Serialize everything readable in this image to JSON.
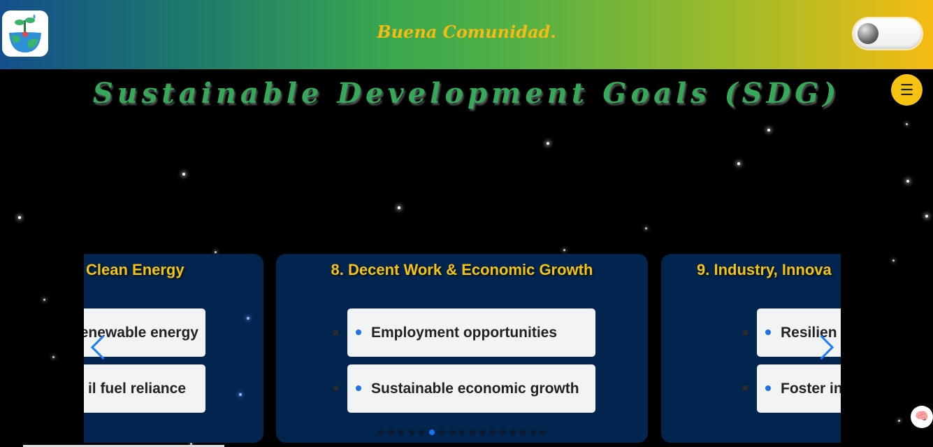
{
  "header": {
    "brand_text": "Buena Comunidad.",
    "logo_icon": "sdg-earth-plant-logo",
    "theme_toggle_state": "off"
  },
  "page_title": "Sustainable Development Goals (SDG)",
  "menu_button": {
    "label": "☰"
  },
  "carousel": {
    "cards": [
      {
        "title": "Clean Energy",
        "items": [
          "enewable energy",
          "il fuel reliance"
        ]
      },
      {
        "title": "8. Decent Work & Economic Growth",
        "items": [
          "Employment opportunities",
          "Sustainable economic growth"
        ]
      },
      {
        "title": "9. Industry, Innova",
        "items": [
          "Resilien",
          "Foster in"
        ]
      }
    ],
    "prev_icon": "chevron-left-icon",
    "next_icon": "chevron-right-icon",
    "pagination_count": 17,
    "active_page_index": 5
  },
  "floating": {
    "assistant_icon": "brain-icon",
    "glyph": "🧠"
  },
  "colors": {
    "accent_yellow": "#f5c211",
    "card_bg": "#022550",
    "title_green": "#36a85a",
    "bullet_blue": "#1a73e8"
  }
}
